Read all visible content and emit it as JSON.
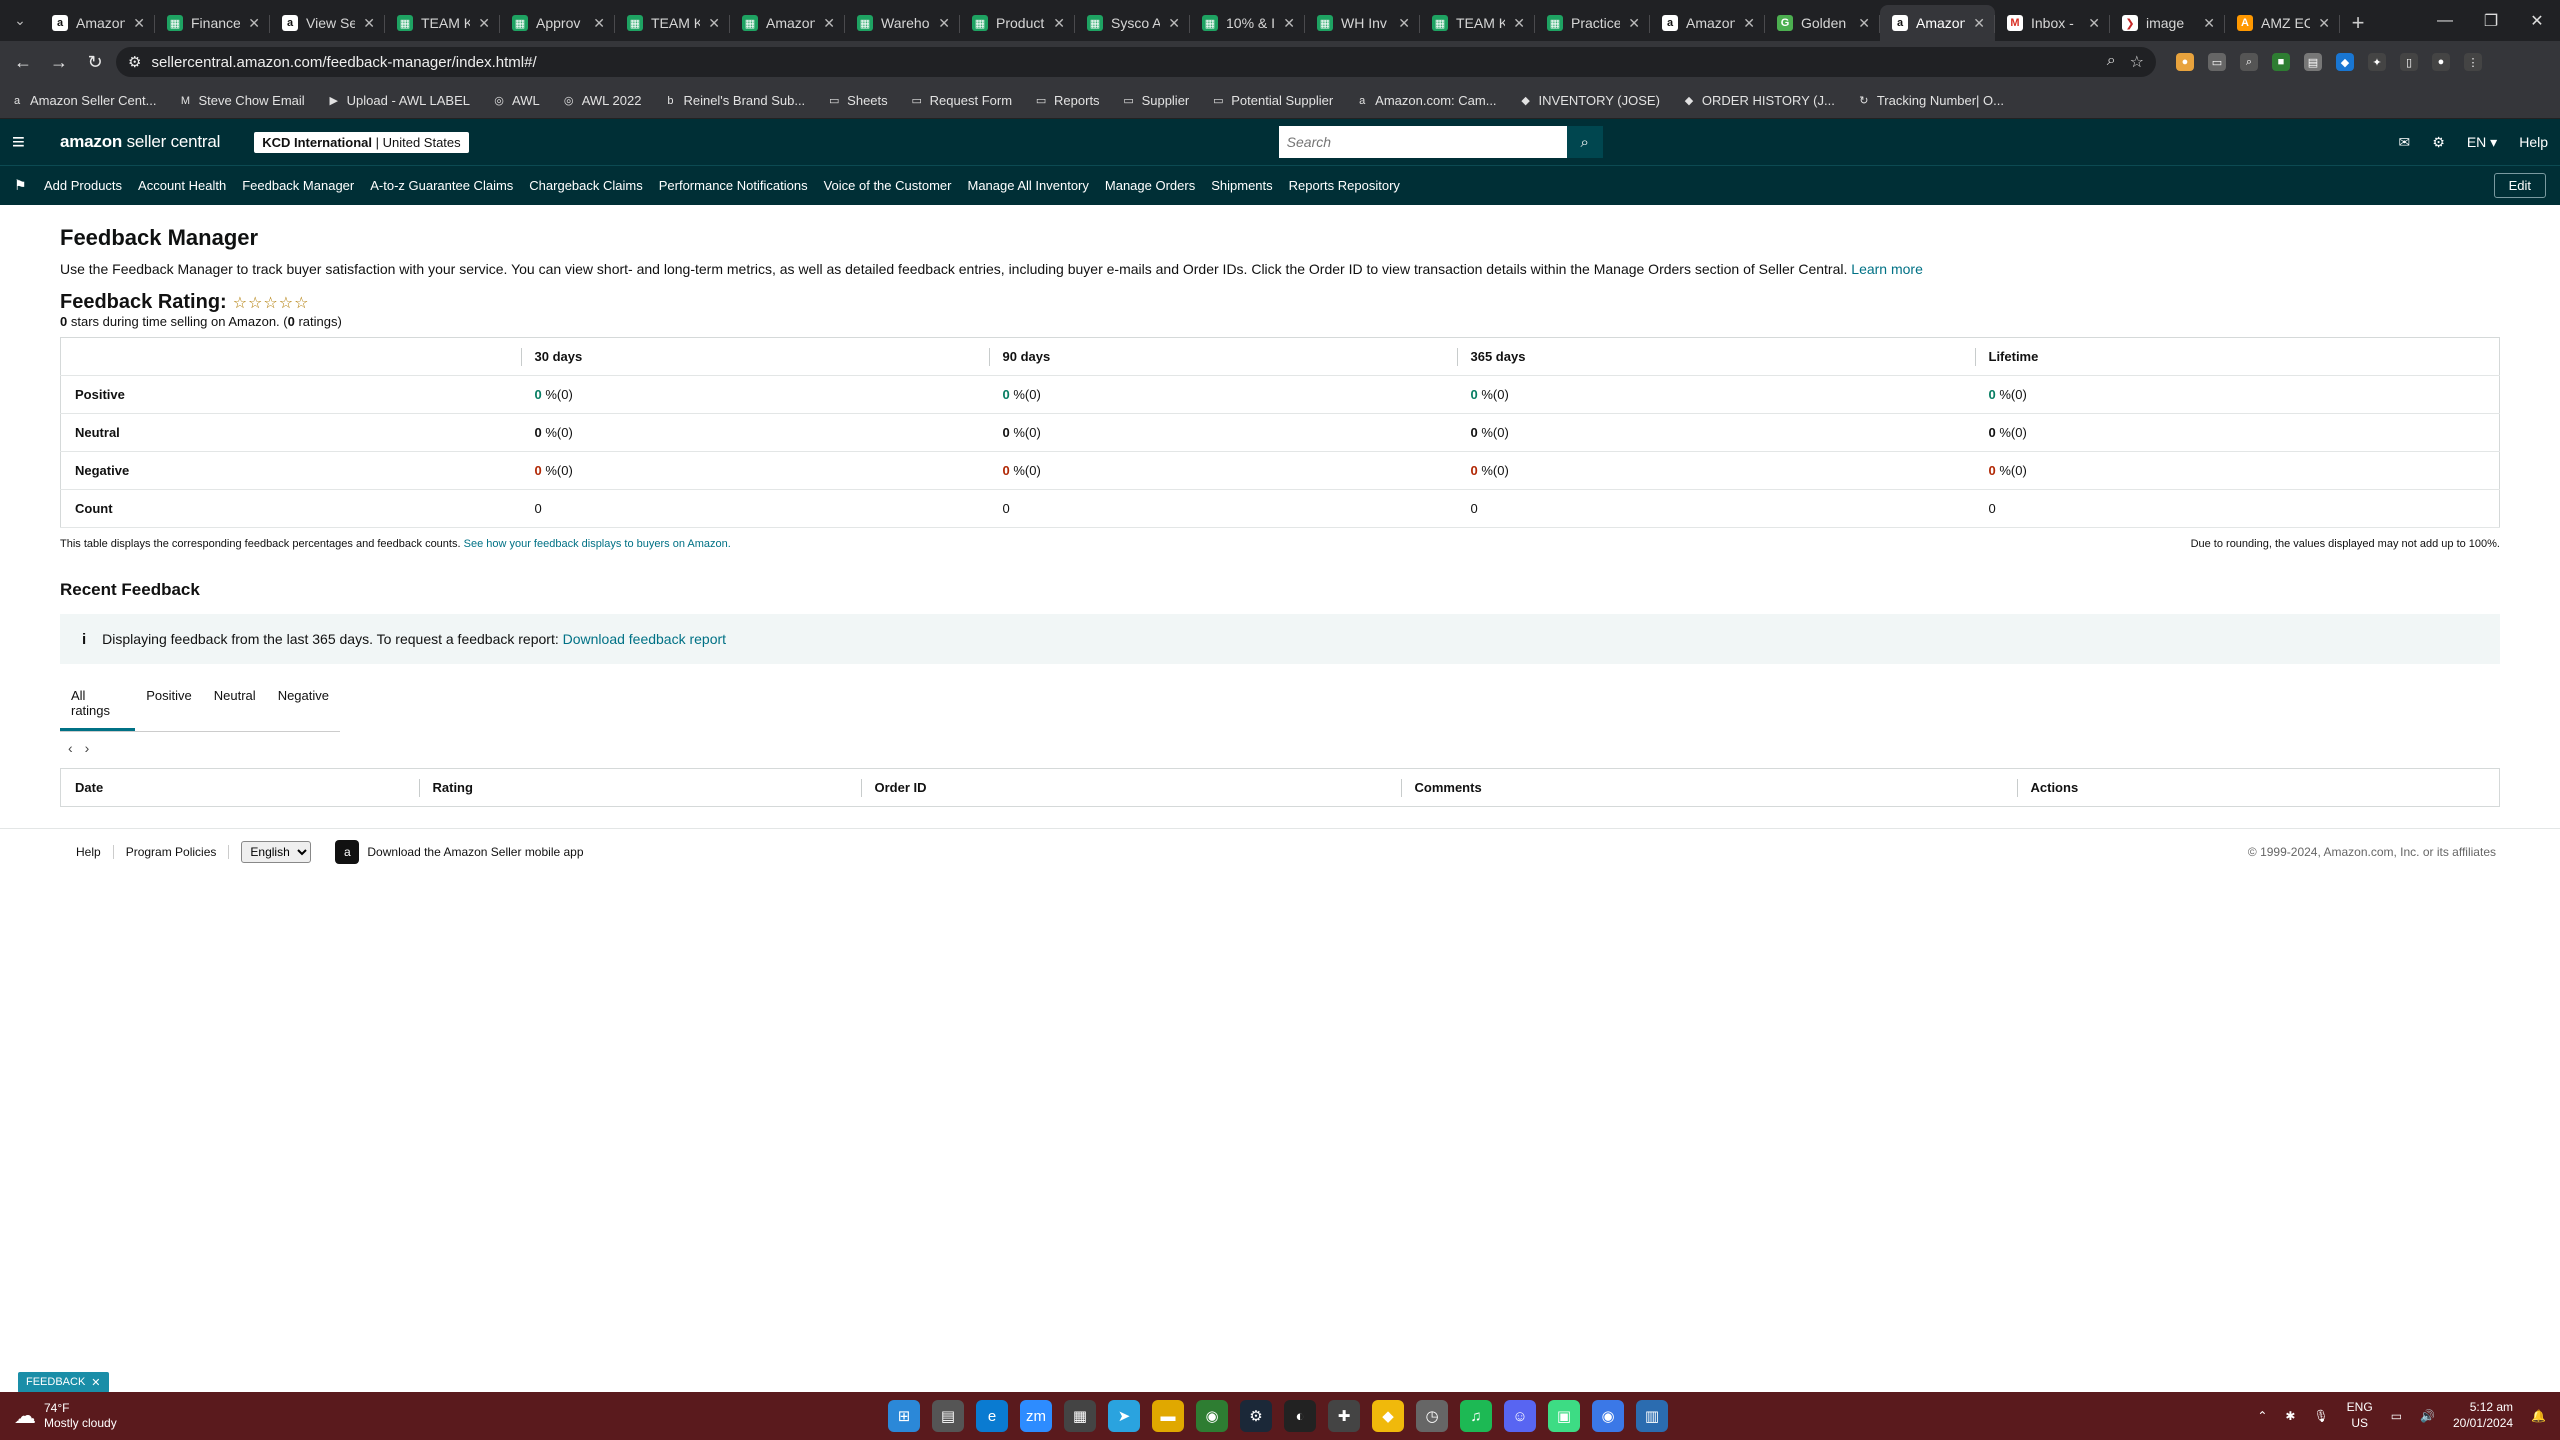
{
  "browser": {
    "tabs": [
      {
        "title": "Amazon",
        "icon": "amazon"
      },
      {
        "title": "Finance",
        "icon": "sheets"
      },
      {
        "title": "View Se",
        "icon": "amazon"
      },
      {
        "title": "TEAM K",
        "icon": "sheets"
      },
      {
        "title": "Approv",
        "icon": "sheets"
      },
      {
        "title": "TEAM K",
        "icon": "sheets"
      },
      {
        "title": "Amazon",
        "icon": "sheets"
      },
      {
        "title": "Wareho",
        "icon": "sheets"
      },
      {
        "title": "Product",
        "icon": "sheets"
      },
      {
        "title": "Sysco A",
        "icon": "sheets"
      },
      {
        "title": "10% & I",
        "icon": "sheets"
      },
      {
        "title": "WH Inv",
        "icon": "sheets"
      },
      {
        "title": "TEAM K",
        "icon": "sheets"
      },
      {
        "title": "Practice",
        "icon": "sheets"
      },
      {
        "title": "Amazon",
        "icon": "amazon"
      },
      {
        "title": "Golden",
        "icon": "golden"
      },
      {
        "title": "Amazon",
        "icon": "amazon",
        "active": true
      },
      {
        "title": "Inbox -",
        "icon": "gmail"
      },
      {
        "title": "image",
        "icon": "image"
      },
      {
        "title": "AMZ EC",
        "icon": "amz"
      }
    ],
    "url": "sellercentral.amazon.com/feedback-manager/index.html#/",
    "bookmarks": [
      {
        "label": "Amazon Seller Cent...",
        "icon": "a"
      },
      {
        "label": "Steve Chow Email",
        "icon": "M"
      },
      {
        "label": "Upload - AWL LABEL",
        "icon": "▶"
      },
      {
        "label": "AWL",
        "icon": "◎"
      },
      {
        "label": "AWL 2022",
        "icon": "◎"
      },
      {
        "label": "Reinel's Brand Sub...",
        "icon": "b"
      },
      {
        "label": "Sheets",
        "icon": "▭"
      },
      {
        "label": "Request Form",
        "icon": "▭"
      },
      {
        "label": "Reports",
        "icon": "▭"
      },
      {
        "label": "Supplier",
        "icon": "▭"
      },
      {
        "label": "Potential Supplier",
        "icon": "▭"
      },
      {
        "label": "Amazon.com: Cam...",
        "icon": "a"
      },
      {
        "label": "INVENTORY (JOSE)",
        "icon": "◆"
      },
      {
        "label": "ORDER HISTORY (J...",
        "icon": "◆"
      },
      {
        "label": "Tracking Number| O...",
        "icon": "↻"
      }
    ]
  },
  "header": {
    "logo_main": "amazon",
    "logo_sub": "seller central",
    "account_name": "KCD International",
    "account_region": "United States",
    "search_placeholder": "Search",
    "language": "EN",
    "help": "Help"
  },
  "nav": {
    "links": [
      "Add Products",
      "Account Health",
      "Feedback Manager",
      "A-to-z Guarantee Claims",
      "Chargeback Claims",
      "Performance Notifications",
      "Voice of the Customer",
      "Manage All Inventory",
      "Manage Orders",
      "Shipments",
      "Reports Repository"
    ],
    "edit": "Edit"
  },
  "page": {
    "title": "Feedback Manager",
    "description": "Use the Feedback Manager to track buyer satisfaction with your service. You can view short- and long-term metrics, as well as detailed feedback entries, including buyer e-mails and Order IDs. Click the Order ID to view transaction details within the Manage Orders section of Seller Central.",
    "learn_more": "Learn more",
    "rating_title": "Feedback Rating:",
    "stars": "☆☆☆☆☆",
    "rating_stars_value": "0",
    "rating_sub_mid": " stars during time selling on Amazon. (",
    "rating_count": "0",
    "rating_sub_end": " ratings)"
  },
  "metrics": {
    "columns": [
      "30 days",
      "90 days",
      "365 days",
      "Lifetime"
    ],
    "rows": [
      {
        "label": "Positive",
        "kind": "pos",
        "cells": [
          {
            "v": "0",
            "s": " %(0)"
          },
          {
            "v": "0",
            "s": " %(0)"
          },
          {
            "v": "0",
            "s": " %(0)"
          },
          {
            "v": "0",
            "s": " %(0)"
          }
        ]
      },
      {
        "label": "Neutral",
        "kind": "neu",
        "cells": [
          {
            "v": "0",
            "s": " %(0)"
          },
          {
            "v": "0",
            "s": " %(0)"
          },
          {
            "v": "0",
            "s": " %(0)"
          },
          {
            "v": "0",
            "s": " %(0)"
          }
        ]
      },
      {
        "label": "Negative",
        "kind": "neg",
        "cells": [
          {
            "v": "0",
            "s": " %(0)"
          },
          {
            "v": "0",
            "s": " %(0)"
          },
          {
            "v": "0",
            "s": " %(0)"
          },
          {
            "v": "0",
            "s": " %(0)"
          }
        ]
      },
      {
        "label": "Count",
        "kind": "count",
        "cells": [
          {
            "v": "0",
            "s": ""
          },
          {
            "v": "0",
            "s": ""
          },
          {
            "v": "0",
            "s": ""
          },
          {
            "v": "0",
            "s": ""
          }
        ]
      }
    ],
    "note_left": "This table displays the corresponding feedback percentages and feedback counts.",
    "note_left_link": "See how your feedback displays to buyers on Amazon.",
    "note_right": "Due to rounding, the values displayed may not add up to 100%."
  },
  "recent": {
    "title": "Recent Feedback",
    "info_text": "Displaying feedback from the last 365 days. To request a feedback report:",
    "info_link": "Download feedback report",
    "tabs": [
      "All ratings",
      "Positive",
      "Neutral",
      "Negative"
    ],
    "columns": [
      "Date",
      "Rating",
      "Order ID",
      "Comments",
      "Actions"
    ]
  },
  "footer": {
    "help": "Help",
    "policies": "Program Policies",
    "language": "English",
    "app": "Download the Amazon Seller mobile app",
    "copyright": "© 1999-2024, Amazon.com, Inc. or its affiliates"
  },
  "feedback_tag": "FEEDBACK",
  "taskbar": {
    "temp": "74°F",
    "weather": "Mostly cloudy",
    "lang_top": "ENG",
    "lang_bottom": "US",
    "time": "5:12 am",
    "date": "20/01/2024",
    "apps": [
      {
        "name": "windows-start",
        "glyph": "⊞",
        "color": "#2b88d8"
      },
      {
        "name": "file-explorer-app",
        "glyph": "▤",
        "color": "#555"
      },
      {
        "name": "edge",
        "glyph": "e",
        "color": "#0a7bd1"
      },
      {
        "name": "zoom",
        "glyph": "zm",
        "color": "#2d8cff"
      },
      {
        "name": "calculator",
        "glyph": "▦",
        "color": "#444"
      },
      {
        "name": "telegram",
        "glyph": "➤",
        "color": "#2aa3df"
      },
      {
        "name": "folder",
        "glyph": "▬",
        "color": "#e0a800"
      },
      {
        "name": "chrome",
        "glyph": "◉",
        "color": "#2e7d32"
      },
      {
        "name": "steam",
        "glyph": "⚙",
        "color": "#1b2838"
      },
      {
        "name": "github",
        "glyph": "◐",
        "color": "#222"
      },
      {
        "name": "gamepad",
        "glyph": "✚",
        "color": "#444"
      },
      {
        "name": "binance",
        "glyph": "◆",
        "color": "#f0b90b"
      },
      {
        "name": "clock",
        "glyph": "◷",
        "color": "#666"
      },
      {
        "name": "spotify",
        "glyph": "♫",
        "color": "#1db954"
      },
      {
        "name": "discord",
        "glyph": "☺",
        "color": "#5865f2"
      },
      {
        "name": "android-studio",
        "glyph": "▣",
        "color": "#3ddc84"
      },
      {
        "name": "chrome-active",
        "glyph": "◉",
        "color": "#3b78e7"
      },
      {
        "name": "notepad",
        "glyph": "▥",
        "color": "#2b6cb0"
      }
    ]
  }
}
